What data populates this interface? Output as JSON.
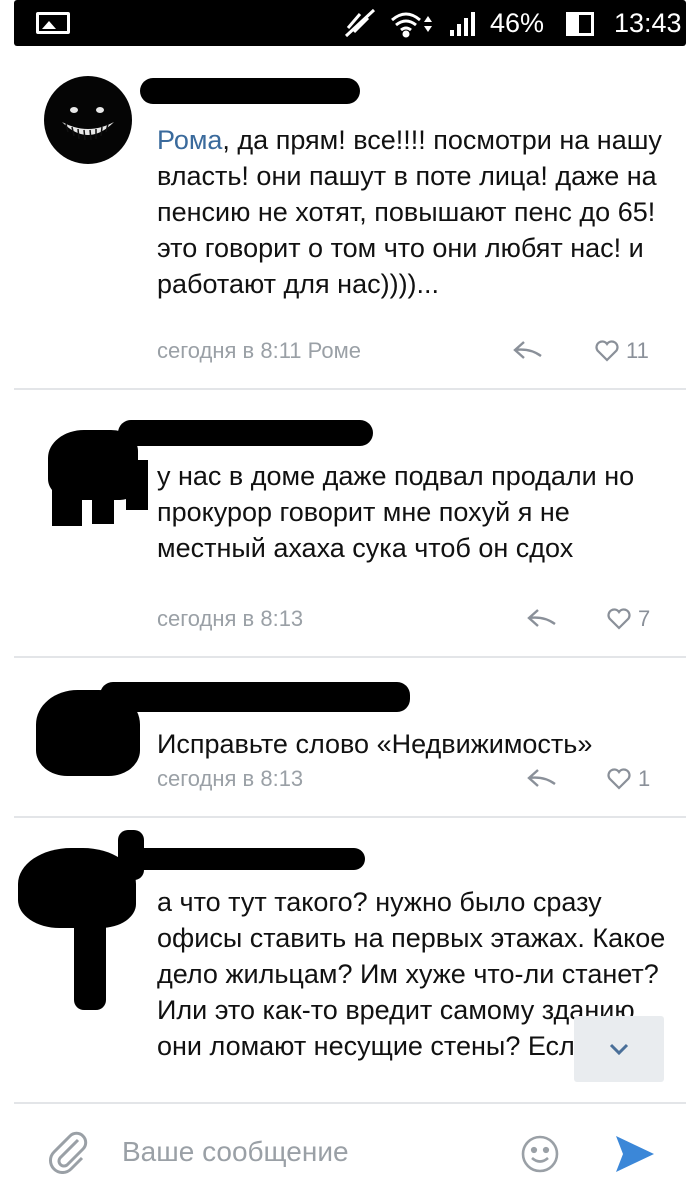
{
  "status_bar": {
    "battery": "46%",
    "time": "13:43"
  },
  "comments": [
    {
      "mention": "Рома",
      "text": ", да прям! все!!!! посмотри на нашу власть! они пашут в поте лица! даже на пенсию не хотят, повышают пенс до 65! это говорит о том что они любят нас! и работают для нас))))...",
      "meta": "сегодня в 8:11 Роме",
      "likes": "11"
    },
    {
      "mention": "",
      "text": "у нас в доме даже подвал продали но прокурор говорит мне похуй я не местный ахаха сука чтоб он сдох",
      "meta": "сегодня в 8:13",
      "likes": "7"
    },
    {
      "mention": "",
      "text": "Исправьте слово «Недвижимость»",
      "meta": "сегодня в 8:13",
      "likes": "1"
    },
    {
      "mention": "",
      "text": "а что тут такого? нужно было сразу офисы ставить на первых этажах. Какое дело жильцам? Им хуже что-ли станет? Или это как-то вредит самому зданию, они ломают несущие стены? Если нет,",
      "meta": "",
      "likes": ""
    }
  ],
  "composer": {
    "placeholder": "Ваше сообщение"
  },
  "icons": {
    "gallery": "gallery-icon",
    "mute": "mute-icon",
    "wifi": "wifi-icon",
    "signal": "signal-icon",
    "battery": "battery-icon",
    "reply": "reply-icon",
    "like": "heart-icon",
    "scroll_down": "chevron-down-icon",
    "attach": "paperclip-icon",
    "emoji": "emoji-icon",
    "send": "send-icon"
  },
  "colors": {
    "link": "#3a6a9c",
    "meta": "#9aa0a6",
    "send": "#3b87d8"
  }
}
